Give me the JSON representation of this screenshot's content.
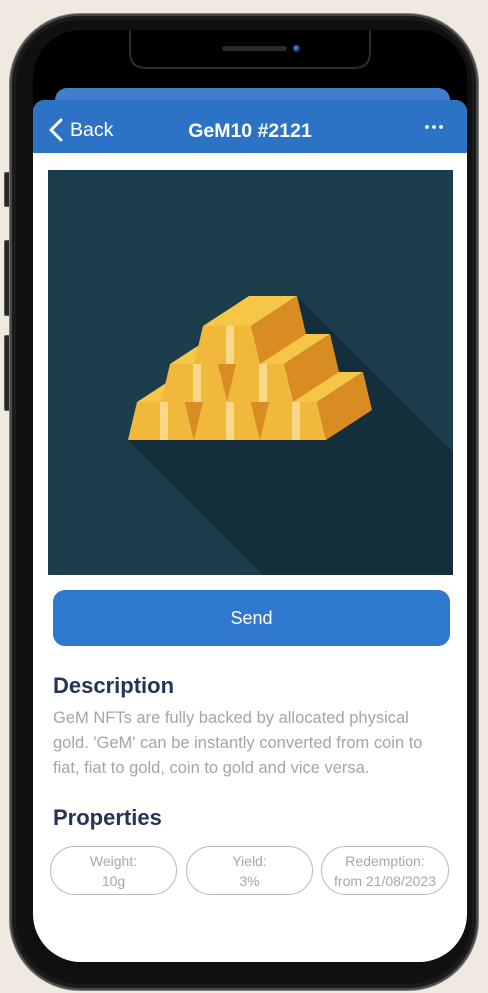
{
  "nav": {
    "back_label": "Back",
    "title": "GeM10 #2121",
    "back_icon": "chevron-left-icon",
    "more_icon": "more-horizontal-icon"
  },
  "artwork": {
    "icon": "gold-bars-illustration"
  },
  "actions": {
    "send_label": "Send"
  },
  "description": {
    "heading": "Description",
    "lines": [
      "GeM NFTs are fully backed by allocated physical",
      "gold. 'GeM' can be instantly converted from coin to",
      "fiat, fiat to gold, coin to gold and vice versa."
    ]
  },
  "properties": {
    "heading": "Properties",
    "items": [
      {
        "label": "Weight:",
        "value": "10g"
      },
      {
        "label": "Yield:",
        "value": "3%"
      },
      {
        "label": "Redemption:",
        "value": "from 21/08/2023"
      }
    ]
  },
  "colors": {
    "page_background": "#efe9df",
    "header_blue": "#2d73c5",
    "button_blue": "#2e78cd",
    "heading_text": "#253358",
    "body_text": "#a5a5a5",
    "artwork_background": "#1c3d4b",
    "gold": "#f1b93b"
  }
}
